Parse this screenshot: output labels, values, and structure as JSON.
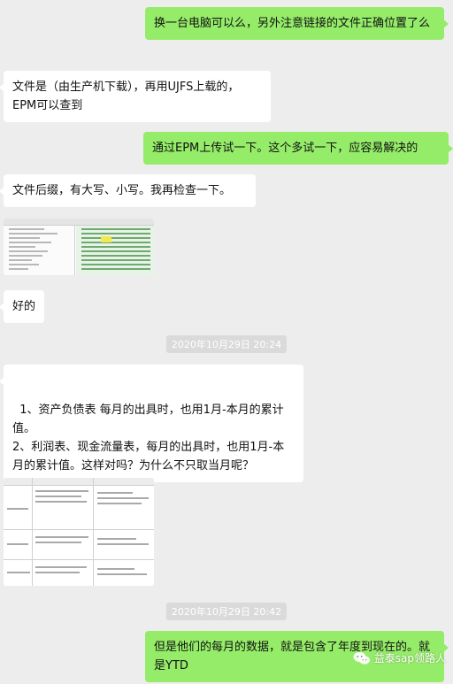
{
  "messages": [
    {
      "id": "m1",
      "side": "out",
      "text": "换一台电脑可以么，另外注意链接的文件正确位置了么"
    },
    {
      "id": "m2",
      "side": "in",
      "text": "文件是（由生产机下载），再用UJFS上载的，EPM可以查到"
    },
    {
      "id": "m3",
      "side": "out",
      "text": "通过EPM上传试一下。这个多试一下，应容易解决的"
    },
    {
      "id": "m4",
      "side": "in",
      "text": "文件后缀，有大写、小写。我再检查一下。"
    },
    {
      "id": "m5",
      "side": "in",
      "type": "image",
      "icon": "file-tree-screenshot-thumbnail"
    },
    {
      "id": "m6",
      "side": "in",
      "text": "好的"
    },
    {
      "id": "t1",
      "type": "timestamp",
      "text": "2020年10月29日 20:24"
    },
    {
      "id": "m7",
      "side": "in",
      "text": "1、资产负债表 每月的出具时，也用1月-本月的累计值。\n2、利润表、现金流量表，每月的出具时，也用1月-本月的累计值。这样对吗？为什么不只取当月呢？"
    },
    {
      "id": "m8",
      "side": "in",
      "type": "image",
      "icon": "table-screenshot-thumbnail"
    },
    {
      "id": "t2",
      "type": "timestamp",
      "text": "2020年10月29日 20:42"
    },
    {
      "id": "m9",
      "side": "out",
      "text": "但是他们的每月的数据，就是包含了年度到现在的。就是YTD"
    }
  ],
  "watermark": {
    "text": "益泰sap领路人",
    "icon": "wechat-official-account-icon"
  },
  "colors": {
    "background": "#ededed",
    "outgoing": "#95ec69",
    "incoming": "#ffffff",
    "timestamp_bg": "#dadada"
  }
}
